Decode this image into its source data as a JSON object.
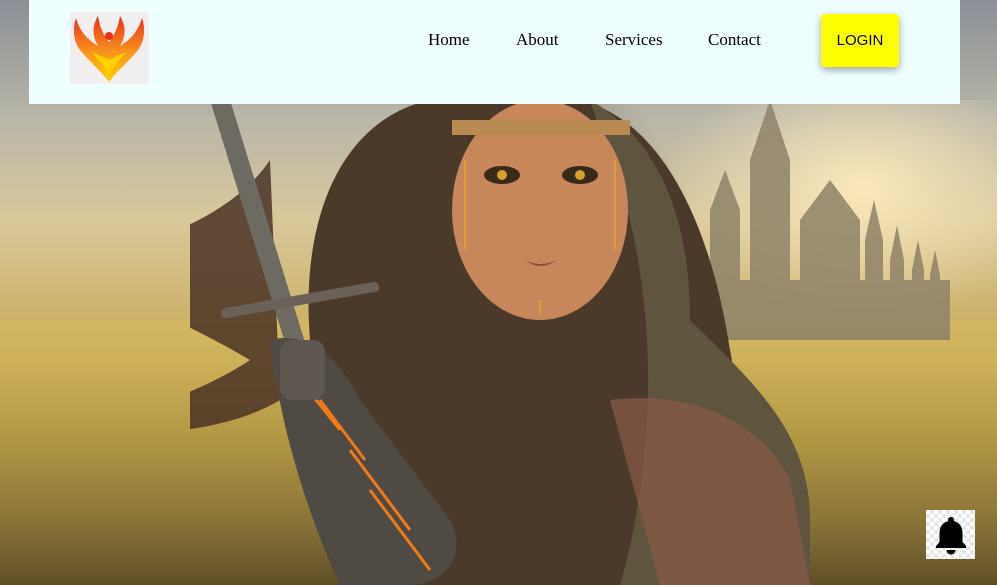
{
  "navbar": {
    "links": [
      {
        "label": "Home"
      },
      {
        "label": "About"
      },
      {
        "label": "Services"
      },
      {
        "label": "Contact"
      }
    ],
    "login_label": "LOGIN"
  },
  "colors": {
    "navbar_bg": "#effefe",
    "login_bg": "#ffff00",
    "logo_flame_red": "#e8301c",
    "logo_flame_orange": "#f7941d",
    "logo_flame_yellow": "#ffd200"
  },
  "icons": {
    "logo": "phoenix-logo-icon",
    "notification": "bell-icon"
  }
}
